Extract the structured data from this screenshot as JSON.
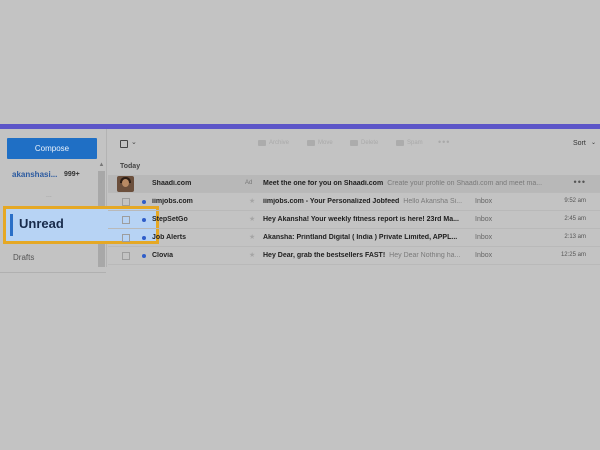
{
  "sidebar": {
    "compose_label": "Compose",
    "account_name": "akanshasi...",
    "account_count": "999+",
    "faint_folder": "...",
    "unread_label": "Unread",
    "drafts_label": "Drafts",
    "scroll_up": "▲"
  },
  "toolbar": {
    "chevron": "⌄",
    "archive_label": "Archive",
    "move_label": "Move",
    "delete_label": "Delete",
    "spam_label": "Spam",
    "more": "•••",
    "sort_label": "Sort",
    "sort_chevron": "⌄"
  },
  "list": {
    "group_label": "Today",
    "rows": [
      {
        "sender": "Shaadi.com",
        "ad_tag": "Ad",
        "subject": "Meet the one for you on Shaadi.com",
        "preview": "Create your profile on Shaadi.com and meet ma...",
        "folder": "",
        "time": "",
        "more": "•••"
      },
      {
        "sender": "iimjobs.com",
        "subject": "iimjobs.com - Your Personalized Jobfeed",
        "preview": "Hello Akansha Si...",
        "folder": "Inbox",
        "time": "9:52 am"
      },
      {
        "sender": "StepSetGo",
        "subject": "Hey Akansha! Your weekly fitness report is here! 23rd Ma...",
        "preview": "",
        "folder": "Inbox",
        "time": "2:45 am"
      },
      {
        "sender": "Job Alerts",
        "subject": "Akansha: Printland Digital ( India ) Private Limited, APPL...",
        "preview": "",
        "folder": "Inbox",
        "time": "2:13 am"
      },
      {
        "sender": "Clovia",
        "subject": "Hey Dear, grab the bestsellers FAST!",
        "preview": "Hey Dear Nothing ha...",
        "folder": "Inbox",
        "time": "12:25 am"
      }
    ]
  },
  "colors": {
    "accent_bar": "#5c55c8",
    "compose": "#1f6fc5",
    "highlight_border": "#e5a825",
    "highlight_fill": "#b7d3f4",
    "unread_dot": "#2f5dc9"
  }
}
